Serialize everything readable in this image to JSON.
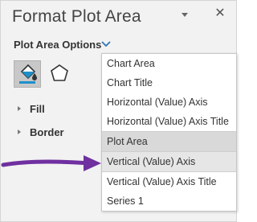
{
  "pane": {
    "title": "Format Plot Area",
    "close_glyph": "✕"
  },
  "options": {
    "label": "Plot Area Options"
  },
  "tabs": [
    {
      "name": "fill-line-icon",
      "selected": true
    },
    {
      "name": "effects-pentagon-icon",
      "selected": false
    }
  ],
  "sections": {
    "fill_label": "Fill",
    "border_label": "Border"
  },
  "dropdown": {
    "items": [
      {
        "label": "Chart Area"
      },
      {
        "label": "Chart Title"
      },
      {
        "label": "Horizontal (Value) Axis"
      },
      {
        "label": "Horizontal (Value) Axis Title"
      },
      {
        "label": "Plot Area",
        "state": "current"
      },
      {
        "label": "Vertical (Value) Axis",
        "state": "hover"
      },
      {
        "label": "Vertical (Value) Axis Title"
      },
      {
        "label": "Series 1"
      }
    ]
  },
  "colors": {
    "annotation_arrow": "#7030a0",
    "chevron": "#2e75b6",
    "fill_bucket": "#1e8fc9"
  }
}
